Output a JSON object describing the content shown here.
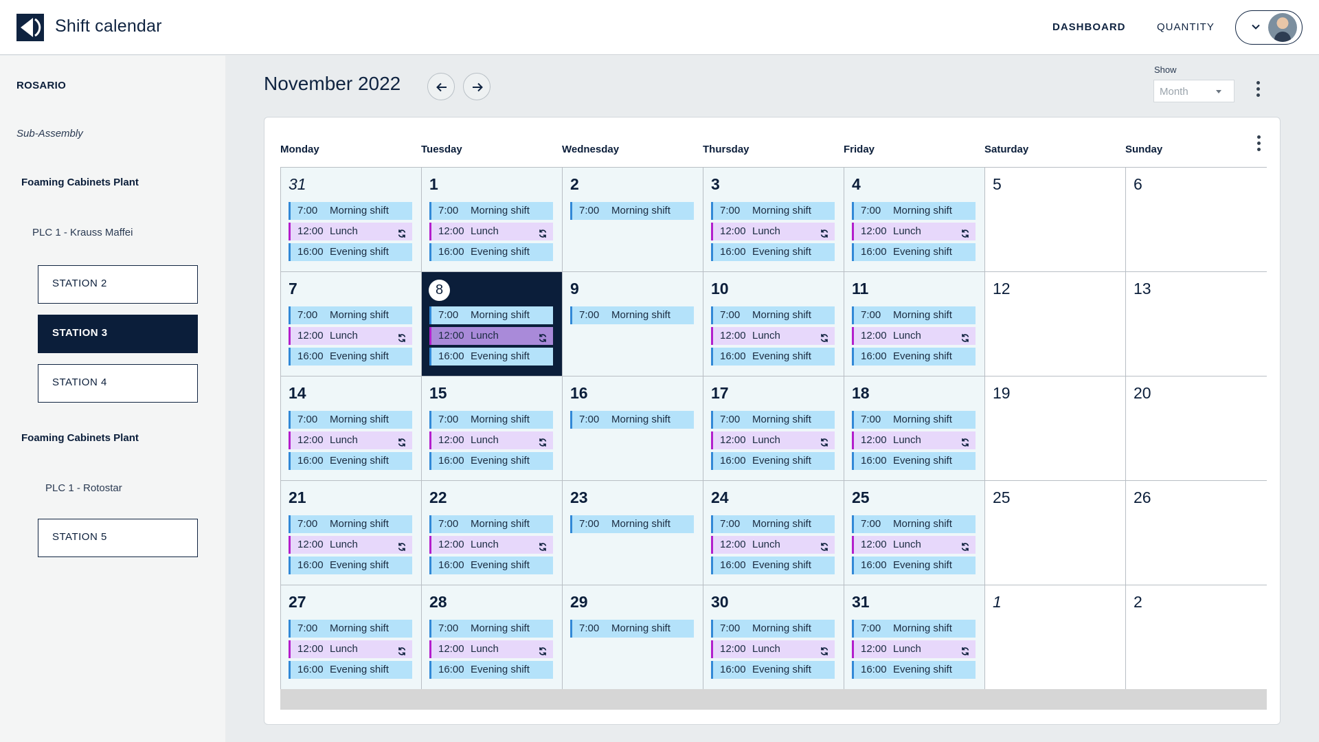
{
  "header": {
    "app_title": "Shift calendar",
    "nav": {
      "dashboard": "DASHBOARD",
      "quantity": "QUANTITY"
    }
  },
  "sidebar": {
    "title": "ROSARIO",
    "subtitle": "Sub-Assembly",
    "plant1": "Foaming Cabinets Plant",
    "plc1": "PLC 1 - Krauss Maffei",
    "station2": "STATION 2",
    "station3": "STATION 3",
    "station4": "STATION 4",
    "plant2": "Foaming Cabinets Plant",
    "plc2": "PLC 1 - Rotostar",
    "station5": "STATION 5",
    "active_station": "STATION 3"
  },
  "calendar": {
    "month_title": "November 2022",
    "show_label": "Show",
    "show_value": "Month",
    "weekdays": [
      "Monday",
      "Tuesday",
      "Wednesday",
      "Thursday",
      "Friday",
      "Saturday",
      "Sunday"
    ],
    "today": "8",
    "events": {
      "morning": {
        "time": "7:00",
        "label": "Morning shift"
      },
      "lunch": {
        "time": "12:00",
        "label": "Lunch"
      },
      "evening": {
        "time": "16:00",
        "label": "Evening shift"
      }
    },
    "weeks": [
      [
        {
          "d": "31",
          "other": true,
          "ev": [
            "morning",
            "lunch",
            "evening"
          ]
        },
        {
          "d": "1",
          "ev": [
            "morning",
            "lunch",
            "evening"
          ]
        },
        {
          "d": "2",
          "ev": [
            "morning"
          ]
        },
        {
          "d": "3",
          "ev": [
            "morning",
            "lunch",
            "evening"
          ]
        },
        {
          "d": "4",
          "ev": [
            "morning",
            "lunch",
            "evening"
          ]
        },
        {
          "d": "5",
          "we": true,
          "ev": []
        },
        {
          "d": "6",
          "we": true,
          "ev": []
        }
      ],
      [
        {
          "d": "7",
          "ev": [
            "morning",
            "lunch",
            "evening"
          ]
        },
        {
          "d": "8",
          "today": true,
          "ev": [
            "morning",
            "lunch",
            "evening"
          ]
        },
        {
          "d": "9",
          "ev": [
            "morning"
          ]
        },
        {
          "d": "10",
          "ev": [
            "morning",
            "lunch",
            "evening"
          ]
        },
        {
          "d": "11",
          "ev": [
            "morning",
            "lunch",
            "evening"
          ]
        },
        {
          "d": "12",
          "we": true,
          "ev": []
        },
        {
          "d": "13",
          "we": true,
          "ev": []
        }
      ],
      [
        {
          "d": "14",
          "ev": [
            "morning",
            "lunch",
            "evening"
          ]
        },
        {
          "d": "15",
          "ev": [
            "morning",
            "lunch",
            "evening"
          ]
        },
        {
          "d": "16",
          "ev": [
            "morning"
          ]
        },
        {
          "d": "17",
          "ev": [
            "morning",
            "lunch",
            "evening"
          ]
        },
        {
          "d": "18",
          "ev": [
            "morning",
            "lunch",
            "evening"
          ]
        },
        {
          "d": "19",
          "we": true,
          "ev": []
        },
        {
          "d": "20",
          "we": true,
          "ev": []
        }
      ],
      [
        {
          "d": "21",
          "ev": [
            "morning",
            "lunch",
            "evening"
          ]
        },
        {
          "d": "22",
          "ev": [
            "morning",
            "lunch",
            "evening"
          ]
        },
        {
          "d": "23",
          "ev": [
            "morning"
          ]
        },
        {
          "d": "24",
          "ev": [
            "morning",
            "lunch",
            "evening"
          ]
        },
        {
          "d": "25",
          "ev": [
            "morning",
            "lunch",
            "evening"
          ]
        },
        {
          "d": "25",
          "we": true,
          "ev": []
        },
        {
          "d": "26",
          "we": true,
          "ev": []
        }
      ],
      [
        {
          "d": "27",
          "ev": [
            "morning",
            "lunch",
            "evening"
          ]
        },
        {
          "d": "28",
          "ev": [
            "morning",
            "lunch",
            "evening"
          ]
        },
        {
          "d": "29",
          "ev": [
            "morning"
          ]
        },
        {
          "d": "30",
          "ev": [
            "morning",
            "lunch",
            "evening"
          ]
        },
        {
          "d": "31",
          "ev": [
            "morning",
            "lunch",
            "evening"
          ]
        },
        {
          "d": "1",
          "we": true,
          "other": true,
          "ev": []
        },
        {
          "d": "2",
          "we": true,
          "ev": []
        }
      ]
    ]
  },
  "colors": {
    "navy": "#0b1e3a",
    "shift_bg": "#b4e2fa",
    "shift_bar": "#3188d6",
    "lunch_bg": "#e7d8fb",
    "lunch_bar": "#b31ecc"
  }
}
